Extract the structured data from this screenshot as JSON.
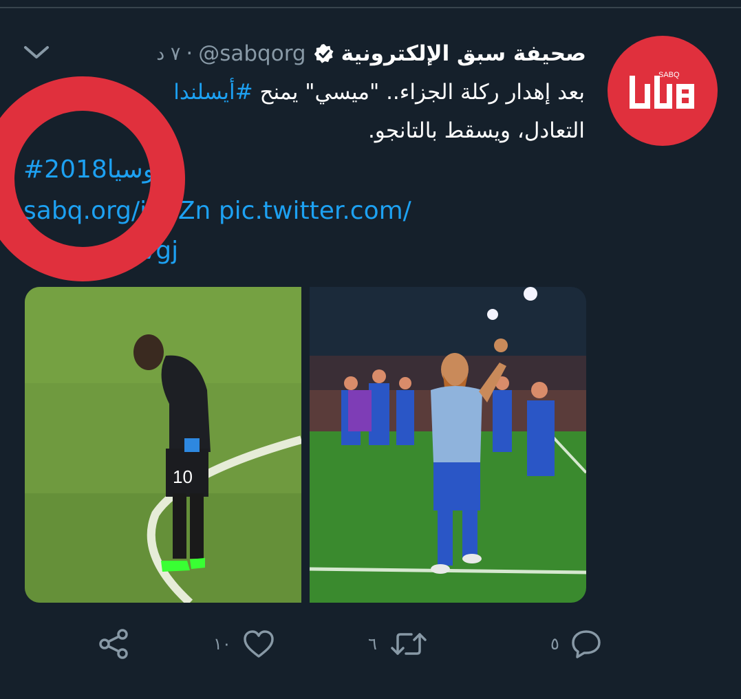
{
  "tweet": {
    "display_name": "صحيفة سبق الإلكترونية",
    "verified": true,
    "handle": "@sabqorg",
    "separator": "·",
    "time": "٧ د",
    "avatar": {
      "logo_text": "SABQ",
      "background": "#e0303d"
    },
    "text_line_1_prefix": "بعد إهدار ركلة الجزاء.. \"ميسي\" يمنح ",
    "text_line_1_hashtag": "#أيسلندا",
    "text_line_2": "التعادل، ويسقط بالتانجو.",
    "hashtag_line": "#روسيا2018",
    "link_line_1": "sabq.org/jb2Zn pic.twitter.com/",
    "link_line_2": "vgj",
    "media": [
      {
        "icon": "photo-messi-penalty"
      },
      {
        "icon": "photo-iceland-celebration"
      }
    ]
  },
  "actions": {
    "reply": {
      "icon": "reply-icon",
      "count": "٥"
    },
    "retweet": {
      "icon": "retweet-icon",
      "count": "٦"
    },
    "like": {
      "icon": "heart-icon",
      "count": "١٠"
    },
    "share": {
      "icon": "share-icon"
    }
  },
  "colors": {
    "background": "#15202b",
    "link": "#1da1f2",
    "secondary_text": "#8899a6",
    "annotation_circle": "#e0303d"
  }
}
